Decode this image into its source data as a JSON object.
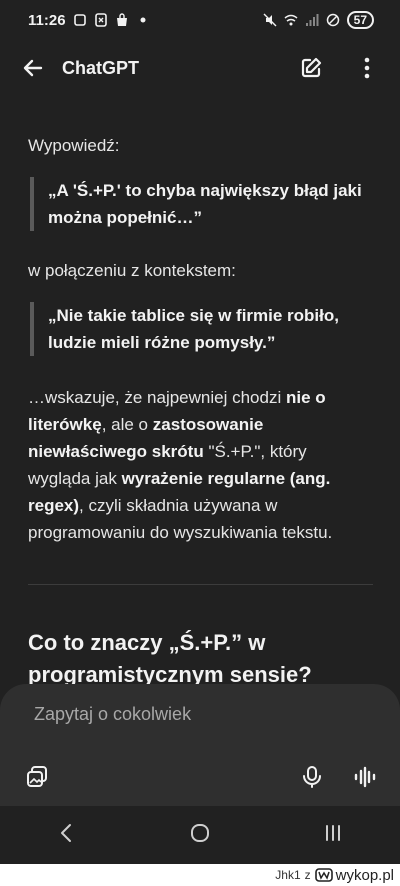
{
  "status_bar": {
    "time": "11:26",
    "battery": "57"
  },
  "header": {
    "title": "ChatGPT",
    "icons": [
      "back-arrow-icon",
      "edit-icon",
      "more-vertical-icon"
    ]
  },
  "message": {
    "p1": "Wypowiedź:",
    "quote1": "„A 'Ś.+P.' to chyba największy błąd jaki można popełnić…”",
    "p2": "w połączeniu z kontekstem:",
    "quote2": "„Nie takie tablice się w firmie robiło, ludzie mieli różne pomysły.”",
    "p3_parts": {
      "a": "…wskazuje, że najpewniej chodzi ",
      "b": "nie o literówkę",
      "c": ", ale o ",
      "d": "zastosowanie niewłaściwego skrótu",
      "e": " \"Ś.+P.\", który wygląda jak ",
      "f": "wyrażenie regularne (ang. regex)",
      "g": ", czyli składnia używana w programowaniu do wyszukiwania tekstu."
    },
    "heading": "Co to znaczy „Ś.+P.” w programistycznym sensie?"
  },
  "composer": {
    "placeholder": "Zapytaj o cokolwiek"
  },
  "watermark": {
    "user": "Jhk1",
    "sep": "z",
    "site": "wykop.pl"
  },
  "colors": {
    "background": "#212121",
    "composer": "#2f2f2f",
    "text": "#ececec"
  }
}
